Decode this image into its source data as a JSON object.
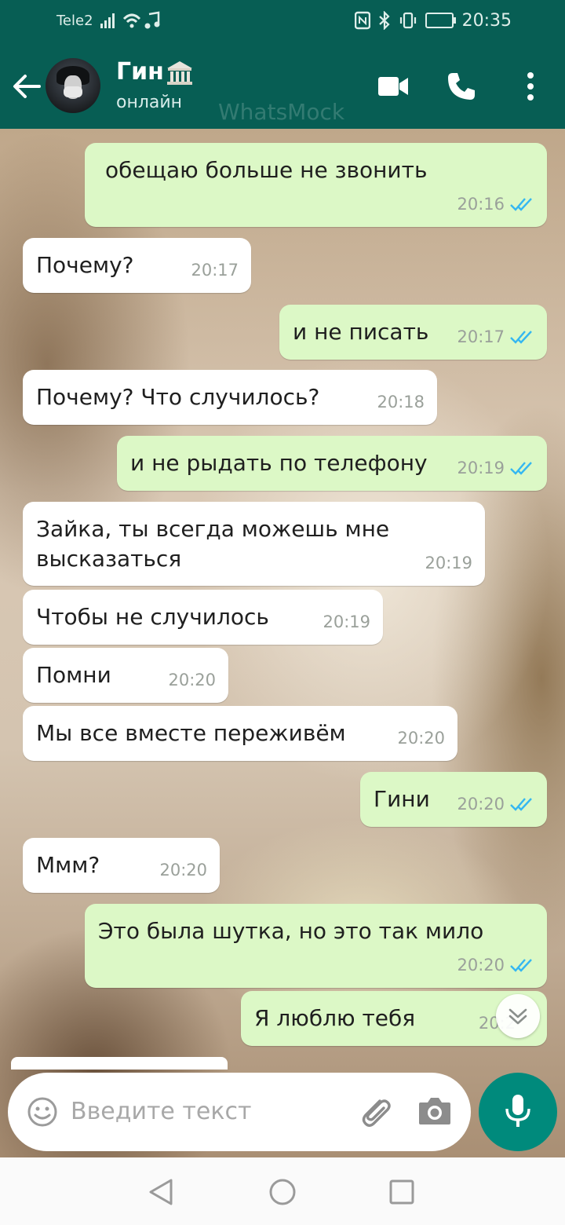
{
  "status_bar": {
    "carrier": "Tele2",
    "time": "20:35",
    "battery": "31"
  },
  "header": {
    "contact_name": "Гин",
    "contact_status": "онлайн",
    "watermark": "WhatsMock"
  },
  "messages": [
    {
      "dir": "out",
      "text": "обещаю больше не звонить",
      "time": "20:16"
    },
    {
      "dir": "in",
      "text": "Почему?",
      "time": "20:17"
    },
    {
      "dir": "out",
      "text": "и не писать",
      "time": "20:17"
    },
    {
      "dir": "in",
      "text": "Почему? Что случилось?",
      "time": "20:18"
    },
    {
      "dir": "out",
      "text": "и не рыдать по телефону",
      "time": "20:19"
    },
    {
      "dir": "in",
      "text": "Зайка, ты всегда можешь мне высказаться",
      "time": "20:19"
    },
    {
      "dir": "in",
      "text": "Чтобы не случилось",
      "time": "20:19"
    },
    {
      "dir": "in",
      "text": "Помни",
      "time": "20:20"
    },
    {
      "dir": "in",
      "text": "Мы все вместе переживём",
      "time": "20:20"
    },
    {
      "dir": "out",
      "text": "Гини",
      "time": "20:20"
    },
    {
      "dir": "in",
      "text": "Ммм?",
      "time": "20:20"
    },
    {
      "dir": "out",
      "text": "Это была шутка, но это так мило",
      "time": "20:20"
    },
    {
      "dir": "out",
      "text": "Я люблю тебя",
      "time": "20:2"
    }
  ],
  "input": {
    "placeholder": "Введите текст"
  },
  "icons": {
    "back": "arrow-left-icon",
    "video": "video-call-icon",
    "call": "phone-icon",
    "menu": "more-vert-icon",
    "emoji": "emoji-icon",
    "attach": "paperclip-icon",
    "camera": "camera-icon",
    "mic": "microphone-icon",
    "read": "double-check-icon",
    "scroll": "chevron-double-down-icon"
  },
  "colors": {
    "header": "#075e54",
    "outgoing_bubble": "#dcf8c6",
    "incoming_bubble": "#ffffff",
    "read_tick": "#34b7f1",
    "mic_button": "#008a7c"
  }
}
